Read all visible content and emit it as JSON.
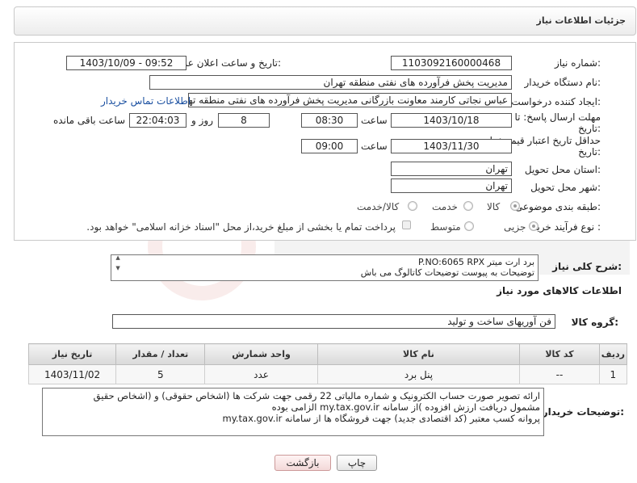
{
  "header": {
    "title": "جزئیات اطلاعات نیاز"
  },
  "form": {
    "need_number_label": "شماره نیاز:",
    "need_number": "1103092160000468",
    "announce_label": "تاریخ و ساعت اعلان عمومی:",
    "announce_value": "1403/10/09 - 09:52",
    "buyer_org_label": "نام دستگاه خریدار:",
    "buyer_org": "مدیریت پخش فرآورده های نفتی منطقه تهران",
    "creator_label": "ایجاد کننده درخواست:",
    "creator": "عباس نجاتی کارمند معاونت بازرگانی مدیریت پخش فرآورده های نفتی منطقه تهران",
    "contact_link": "اطلاعات تماس خریدار",
    "deadline_label_1": "مهلت ارسال پاسخ: تا",
    "deadline_label_2": "تاریخ:",
    "deadline_date": "1403/10/18",
    "time_label": "ساعت",
    "deadline_time": "08:30",
    "days_value": "8",
    "days_label": "روز و",
    "remaining_time": "22:04:03",
    "remaining_label": "ساعت باقی مانده",
    "validity_label_1": "حداقل تاریخ اعتبار قیمت: تا",
    "validity_label_2": "تاریخ:",
    "validity_date": "1403/11/30",
    "validity_time": "09:00",
    "province_label": "استان محل تحویل:",
    "province": "تهران",
    "city_label": "شهر محل تحویل:",
    "city": "تهران",
    "category_label": "طبقه بندی موضوعی:",
    "category_options": [
      "کالا",
      "خدمت",
      "کالا/خدمت"
    ],
    "process_label": "نوع فرآیند خرید :",
    "process_options": [
      "جزیی",
      "متوسط"
    ],
    "payment_note": "پرداخت تمام یا بخشی از مبلغ خرید،از محل \"اسناد خزانه اسلامی\" خواهد بود."
  },
  "summary": {
    "label": "شرح کلی نیاز:",
    "line1": "برد ارت میتر P.NO:6065 RPX",
    "line2": "توضیحات به پیوست توضیحات کاتالوگ می باش"
  },
  "goods": {
    "section_title": "اطلاعات کالاهای مورد نیاز",
    "group_label": "گروه کالا:",
    "group_value": "فن آوریهای ساخت و تولید",
    "columns": [
      "ردیف",
      "کد کالا",
      "نام کالا",
      "واحد شمارش",
      "تعداد / مقدار",
      "تاریخ نیاز"
    ],
    "rows": [
      {
        "row": "1",
        "code": "--",
        "name": "پنل برد",
        "unit": "عدد",
        "qty": "5",
        "date": "1403/11/02"
      }
    ]
  },
  "buyer_notes": {
    "label": "توضیحات خریدار:",
    "line1": "ارائه  تصویر صورت حساب الکترونیک و شماره مالیاتی 22 رقمی  جهت شرکت ها (اشخاص حقوقی) و (اشخاص حقیق",
    "line2": "مشمول دریافت ارزش افزوده )از سامانه my.tax.gov.ir  الزامی بوده",
    "line3": "پروانه کسب معتبر (کد اقتصادی جدید) جهت فروشگاه ها از سامانه my.tax.gov.ir"
  },
  "buttons": {
    "print": "چاپ",
    "back": "بازگشت"
  },
  "colors": {
    "link": "#1a4fa0",
    "border": "#555555",
    "header_bg": "#ececec"
  }
}
